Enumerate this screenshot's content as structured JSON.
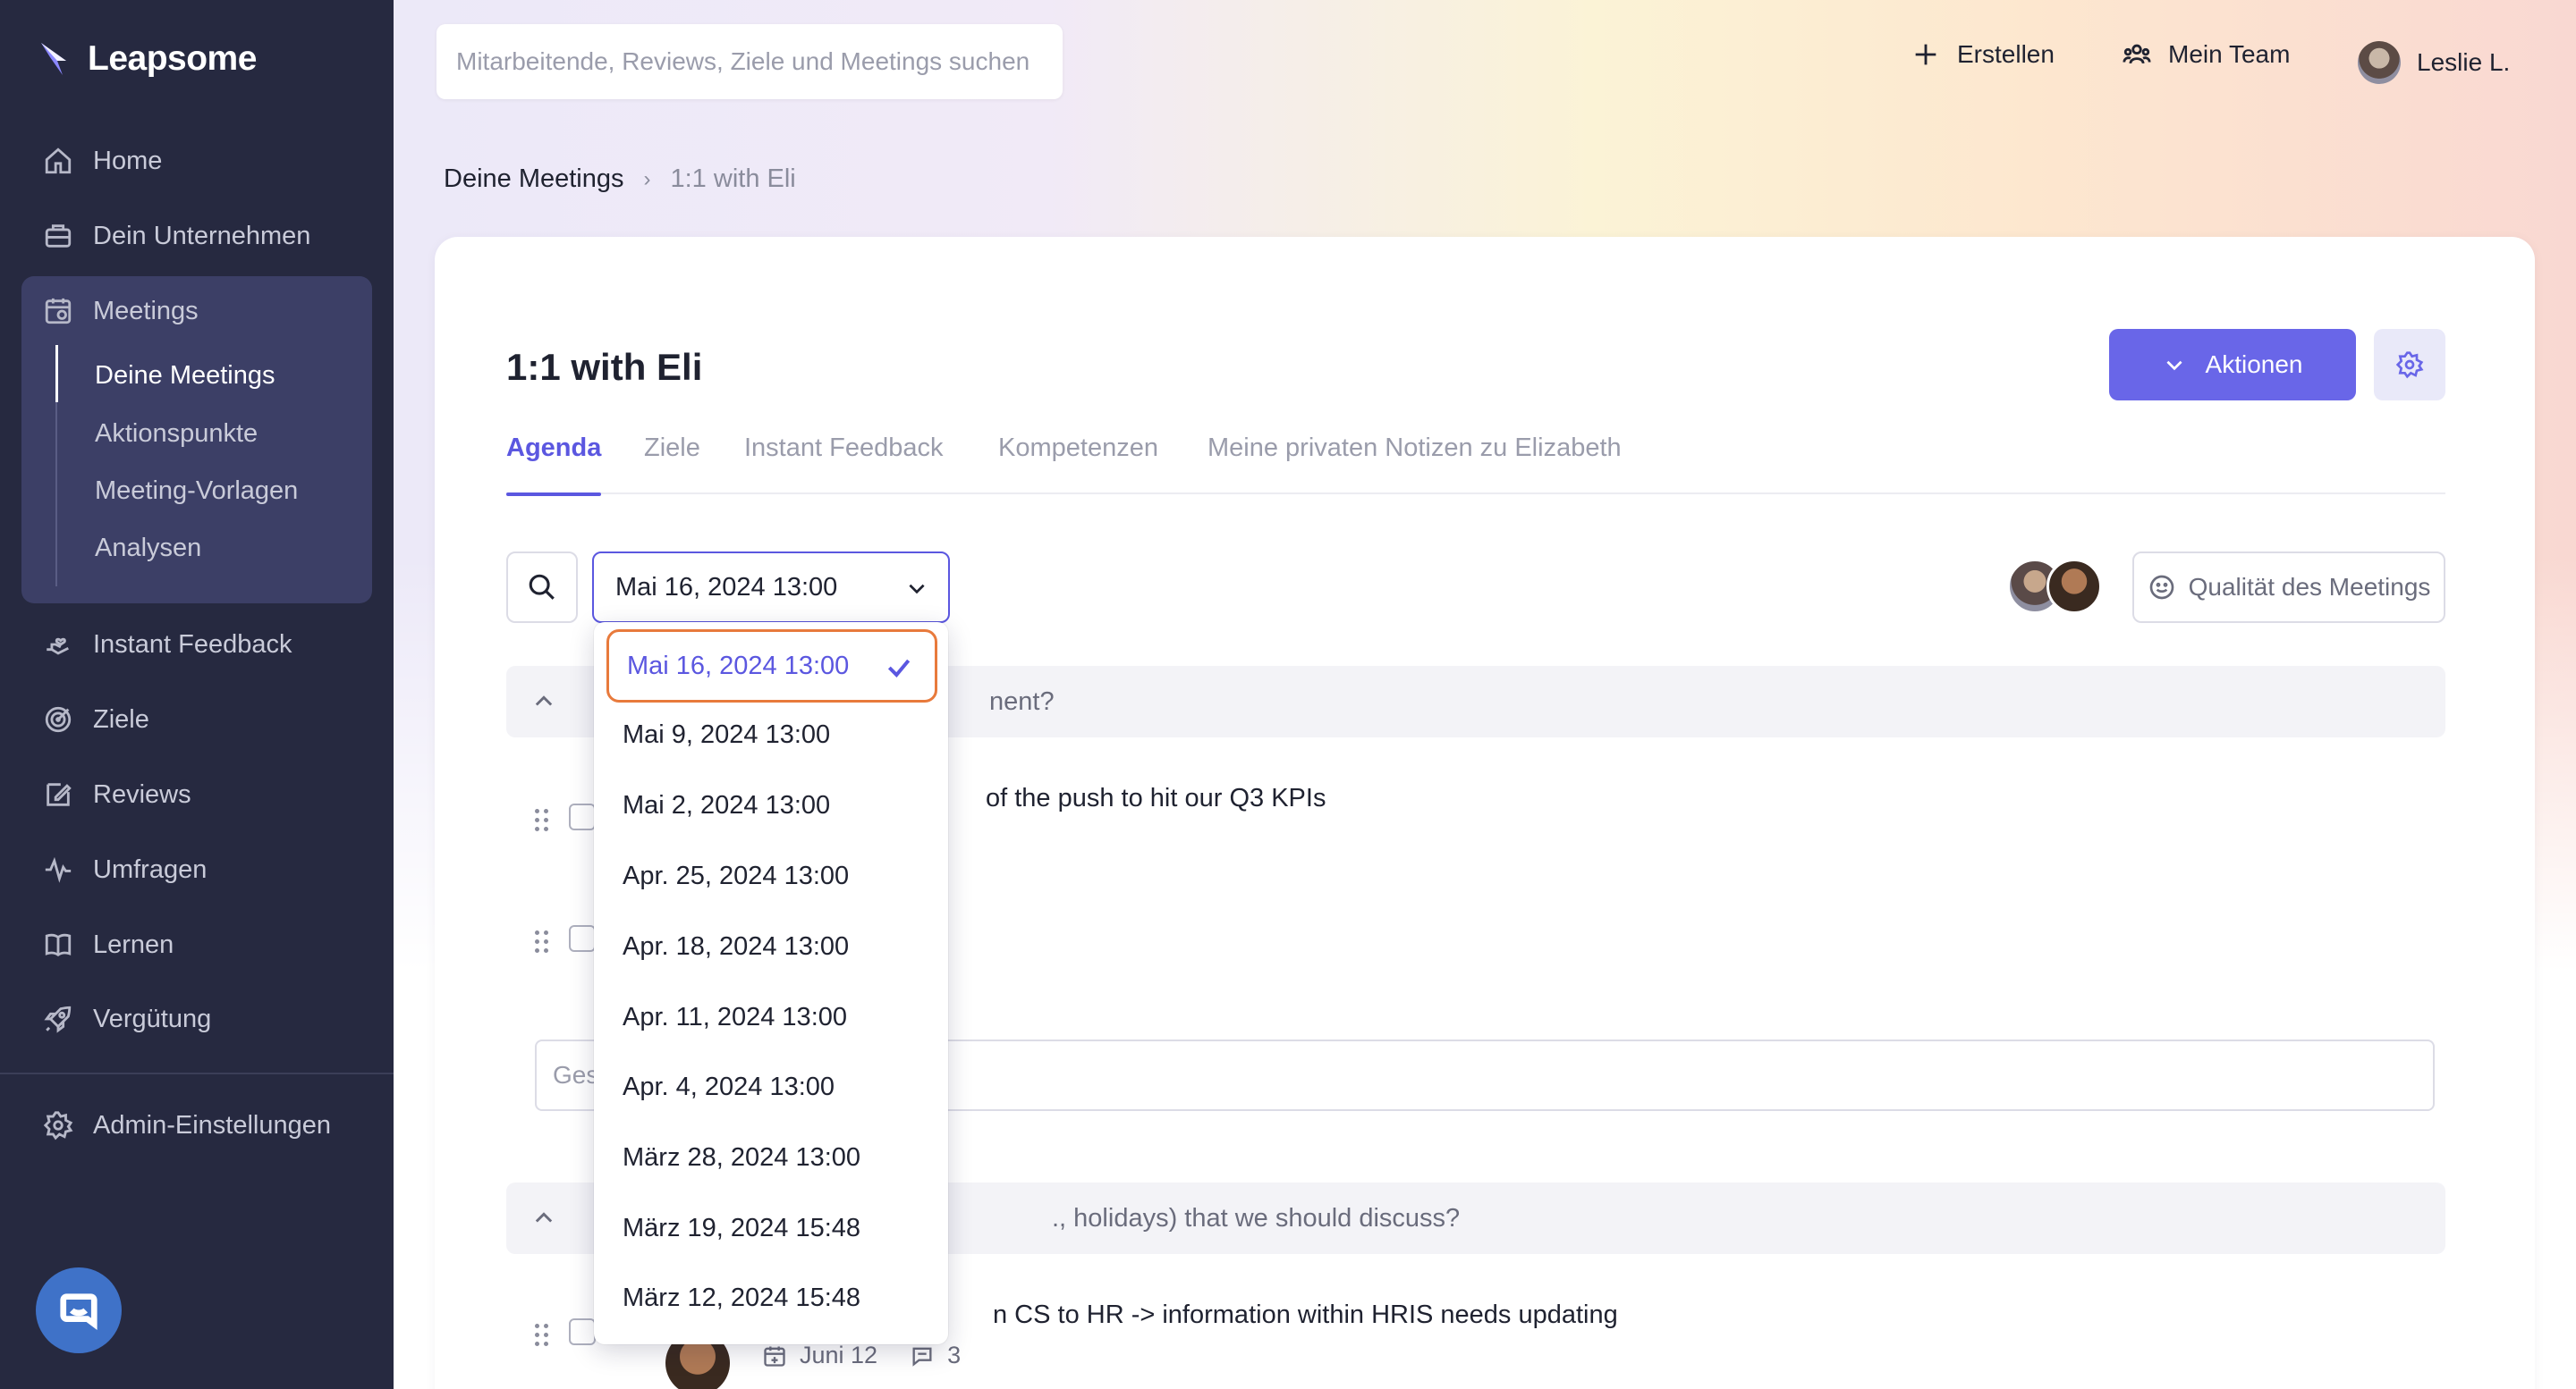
{
  "app": {
    "name": "Leapsome"
  },
  "sidebar": {
    "items": [
      {
        "label": "Home",
        "icon": "home-icon"
      },
      {
        "label": "Dein Unternehmen",
        "icon": "briefcase-icon"
      },
      {
        "label": "Meetings",
        "icon": "meetings-icon"
      },
      {
        "label": "Instant Feedback",
        "icon": "hand-heart-icon"
      },
      {
        "label": "Ziele",
        "icon": "target-icon"
      },
      {
        "label": "Reviews",
        "icon": "edit-icon"
      },
      {
        "label": "Umfragen",
        "icon": "pulse-icon"
      },
      {
        "label": "Lernen",
        "icon": "book-icon"
      },
      {
        "label": "Vergütung",
        "icon": "rocket-icon"
      }
    ],
    "meetings_sub": [
      "Deine Meetings",
      "Aktionspunkte",
      "Meeting-Vorlagen",
      "Analysen"
    ],
    "admin": {
      "label": "Admin-Einstellungen",
      "icon": "gear-icon"
    }
  },
  "header": {
    "search_placeholder": "Mitarbeitende, Reviews, Ziele und Meetings suchen",
    "create_label": "Erstellen",
    "team_label": "Mein Team",
    "user_label": "Leslie L."
  },
  "breadcrumb": {
    "parent": "Deine Meetings",
    "separator": "›",
    "current": "1:1 with Eli"
  },
  "meeting": {
    "title": "1:1 with Eli",
    "actions_label": "Aktionen",
    "tabs": [
      "Agenda",
      "Ziele",
      "Instant Feedback",
      "Kompetenzen",
      "Meine privaten Notizen zu Elizabeth"
    ],
    "active_tab": "Agenda",
    "selected_date": "Mai 16, 2024 13:00",
    "quality_label": "Qualität des Meetings"
  },
  "agenda": {
    "section1_visible": "nent?",
    "item1_visible": "of the push to hit our Q3 KPIs",
    "note_placeholder_visible": "Ges",
    "section2_visible": "., holidays) that we should discuss?",
    "item3_visible": "n CS to HR -> information within HRIS needs updating",
    "item3_date": "Juni 12",
    "item3_comments": "3"
  },
  "date_options": [
    "Mai 16, 2024 13:00",
    "Mai 9, 2024 13:00",
    "Mai 2, 2024 13:00",
    "Apr. 25, 2024 13:00",
    "Apr. 18, 2024 13:00",
    "Apr. 11, 2024 13:00",
    "Apr. 4, 2024 13:00",
    "März 28, 2024 13:00",
    "März 19, 2024 15:48",
    "März 12, 2024 15:48"
  ],
  "colors": {
    "accent": "#5b57e0",
    "button": "#6966e8",
    "sidebar": "#262940",
    "focus_ring": "#e87a3c",
    "chat": "#3f72c8"
  }
}
